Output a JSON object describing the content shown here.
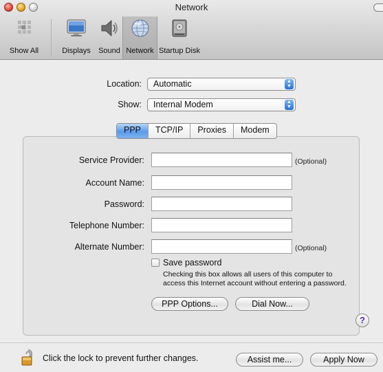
{
  "window": {
    "title": "Network"
  },
  "toolbar": {
    "show_all": "Show All",
    "items": [
      {
        "label": "Displays",
        "icon": "display-icon"
      },
      {
        "label": "Sound",
        "icon": "speaker-icon"
      },
      {
        "label": "Network",
        "icon": "network-globe-icon",
        "selected": true
      },
      {
        "label": "Startup Disk",
        "icon": "hard-disk-icon"
      }
    ]
  },
  "location": {
    "label": "Location:",
    "value": "Automatic"
  },
  "show": {
    "label": "Show:",
    "value": "Internal Modem"
  },
  "tabs": [
    {
      "label": "PPP",
      "active": true
    },
    {
      "label": "TCP/IP"
    },
    {
      "label": "Proxies"
    },
    {
      "label": "Modem"
    }
  ],
  "fields": {
    "service_provider": {
      "label": "Service Provider:",
      "value": "",
      "note": "(Optional)"
    },
    "account_name": {
      "label": "Account Name:",
      "value": ""
    },
    "password": {
      "label": "Password:",
      "value": ""
    },
    "telephone_number": {
      "label": "Telephone Number:",
      "value": ""
    },
    "alternate_number": {
      "label": "Alternate Number:",
      "value": "",
      "note": "(Optional)"
    }
  },
  "save_password": {
    "label": "Save password",
    "checked": false,
    "help_line1": "Checking this box allows all users of this computer to",
    "help_line2": "access this Internet account without entering a password."
  },
  "buttons": {
    "ppp_options": "PPP Options...",
    "dial_now": "Dial Now...",
    "assist_me": "Assist me...",
    "apply_now": "Apply Now",
    "help": "?"
  },
  "lock": {
    "text": "Click the lock to prevent further changes."
  },
  "colors": {
    "tab_active": "#5a9ae9",
    "popup_arrows": "#2a6fd2"
  }
}
